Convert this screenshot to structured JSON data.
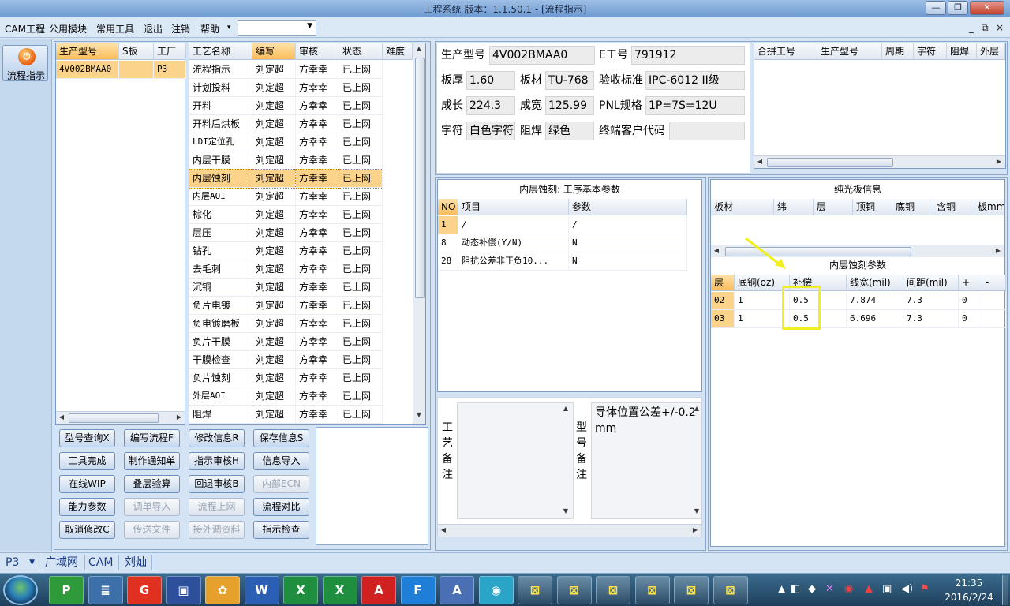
{
  "window": {
    "title": "工程系统   版本：1.1.50.1 - [流程指示]"
  },
  "menu": {
    "items": [
      "CAM工程",
      "公用模块",
      "常用工具",
      "退出",
      "注销",
      "帮助"
    ],
    "help_arrow": "▾",
    "combo_value": ""
  },
  "mdi_controls": [
    "_",
    "⧉",
    "×"
  ],
  "leftbar": {
    "flow_button": "流程指示"
  },
  "products": {
    "columns": [
      "生产型号",
      "S板",
      "工厂"
    ],
    "rows": [
      [
        "4V002BMAA0",
        "",
        "P3"
      ]
    ]
  },
  "processes": {
    "columns": [
      "工艺名称",
      "编写",
      "审核",
      "状态",
      "难度"
    ],
    "rows": [
      [
        "流程指示",
        "刘定超",
        "方幸幸",
        "已上网",
        ""
      ],
      [
        "计划投料",
        "刘定超",
        "方幸幸",
        "已上网",
        ""
      ],
      [
        "开料",
        "刘定超",
        "方幸幸",
        "已上网",
        ""
      ],
      [
        "开料后烘板",
        "刘定超",
        "方幸幸",
        "已上网",
        ""
      ],
      [
        "LDI定位孔",
        "刘定超",
        "方幸幸",
        "已上网",
        ""
      ],
      [
        "内层干膜",
        "刘定超",
        "方幸幸",
        "已上网",
        ""
      ],
      [
        "内层蚀刻",
        "刘定超",
        "方幸幸",
        "已上网",
        ""
      ],
      [
        "内层AOI",
        "刘定超",
        "方幸幸",
        "已上网",
        ""
      ],
      [
        "棕化",
        "刘定超",
        "方幸幸",
        "已上网",
        ""
      ],
      [
        "层压",
        "刘定超",
        "方幸幸",
        "已上网",
        ""
      ],
      [
        "钻孔",
        "刘定超",
        "方幸幸",
        "已上网",
        ""
      ],
      [
        "去毛刺",
        "刘定超",
        "方幸幸",
        "已上网",
        ""
      ],
      [
        "沉铜",
        "刘定超",
        "方幸幸",
        "已上网",
        ""
      ],
      [
        "负片电镀",
        "刘定超",
        "方幸幸",
        "已上网",
        ""
      ],
      [
        "负电镀磨板",
        "刘定超",
        "方幸幸",
        "已上网",
        ""
      ],
      [
        "负片干膜",
        "刘定超",
        "方幸幸",
        "已上网",
        ""
      ],
      [
        "干膜检查",
        "刘定超",
        "方幸幸",
        "已上网",
        ""
      ],
      [
        "负片蚀刻",
        "刘定超",
        "方幸幸",
        "已上网",
        ""
      ],
      [
        "外层AOI",
        "刘定超",
        "方幸幸",
        "已上网",
        ""
      ],
      [
        "阻焊",
        "刘定超",
        "方幸幸",
        "已上网",
        ""
      ]
    ],
    "selected_index": 6
  },
  "buttons": [
    {
      "label": "型号查询X",
      "enabled": true
    },
    {
      "label": "编写流程F",
      "enabled": true
    },
    {
      "label": "修改信息R",
      "enabled": true
    },
    {
      "label": "保存信息S",
      "enabled": true
    },
    {
      "label": "工具完成",
      "enabled": true
    },
    {
      "label": "制作通知单",
      "enabled": true
    },
    {
      "label": "指示审核H",
      "enabled": true
    },
    {
      "label": "信息导入",
      "enabled": true
    },
    {
      "label": "在线WIP",
      "enabled": true
    },
    {
      "label": "叠层验算",
      "enabled": true
    },
    {
      "label": "回退审核B",
      "enabled": true
    },
    {
      "label": "内部ECN",
      "enabled": false
    },
    {
      "label": "能力参数",
      "enabled": true
    },
    {
      "label": "调单导入",
      "enabled": false
    },
    {
      "label": "流程上网",
      "enabled": false
    },
    {
      "label": "流程对比",
      "enabled": true
    },
    {
      "label": "取消修改C",
      "enabled": true
    },
    {
      "label": "传送文件",
      "enabled": false
    },
    {
      "label": "接外调资料",
      "enabled": false
    },
    {
      "label": "指示检查",
      "enabled": true
    }
  ],
  "info": {
    "model_label": "生产型号",
    "model_value": "4V002BMAA0",
    "ejob_label": "E工号",
    "ejob_value": "791912",
    "thickness_label": "板厚",
    "thickness_value": "1.60",
    "material_label": "板材",
    "material_value": "TU-768",
    "standard_label": "验收标准",
    "standard_value": "IPC-6012 II级",
    "length_label": "成长",
    "length_value": "224.3",
    "width_label": "成宽",
    "width_value": "125.99",
    "pnl_label": "PNL规格",
    "pnl_value": "1P=7S=12U",
    "char_label": "字符",
    "char_value": "白色字符",
    "mask_label": "阻焊",
    "mask_value": "绿色",
    "customer_label": "终端客户代码",
    "customer_value": ""
  },
  "combined": {
    "columns": [
      "合拼工号",
      "生产型号",
      "周期",
      "字符",
      "阻焊",
      "外层"
    ]
  },
  "basic_params": {
    "title": "内层蚀刻: 工序基本参数",
    "columns": [
      "NO",
      "项目",
      "参数"
    ],
    "rows": [
      [
        "1",
        "/",
        "/"
      ],
      [
        "8",
        "动态补偿(Y/N)",
        "N"
      ],
      [
        "28",
        "阻抗公差非正负10...",
        "N"
      ]
    ]
  },
  "notes": {
    "process_label": "工艺备注",
    "process_text": "",
    "model_label": "型号备注",
    "model_text": "导体位置公差+/-0.2mm"
  },
  "plain_board": {
    "title": "纯光板信息",
    "columns": [
      "板材",
      "纬",
      "层",
      "顶铜",
      "底铜",
      "含铜",
      "板mm"
    ]
  },
  "etch_params": {
    "title": "内层蚀刻参数",
    "columns": [
      "层",
      "底铜(oz)",
      "补偿",
      "线宽(mil)",
      "间距(mil)",
      "+",
      "-"
    ],
    "rows": [
      [
        "02",
        "1",
        "0.5",
        "7.874",
        "7.3",
        "0",
        ""
      ],
      [
        "03",
        "1",
        "0.5",
        "6.696",
        "7.3",
        "0",
        ""
      ]
    ],
    "highlight_color": "#f0f020"
  },
  "statusbar": {
    "items": [
      "P3",
      "广域网",
      "CAM",
      "刘灿"
    ]
  },
  "taskbar": {
    "apps": [
      "pinned-app",
      "notes",
      "flashget",
      "save",
      "shell",
      "word",
      "excel",
      "excel2",
      "pdf",
      "foxmail",
      "wordpad",
      "browser",
      "window1",
      "window2",
      "window3",
      "window4",
      "window5",
      "window6"
    ],
    "clock_time": "21:35",
    "clock_date": "2016/2/24"
  }
}
